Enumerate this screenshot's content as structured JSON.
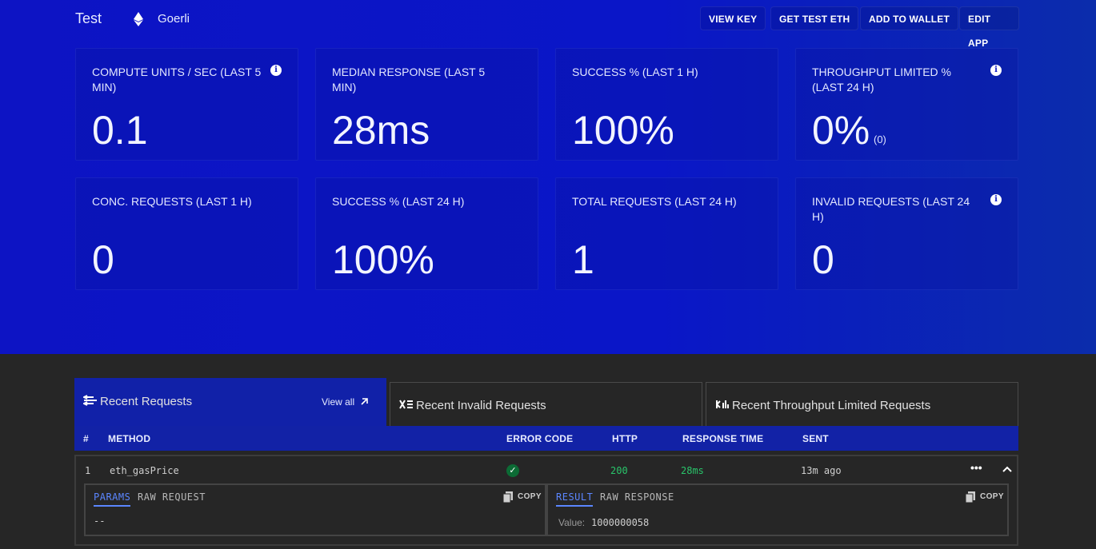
{
  "header": {
    "app_name": "Test",
    "network": "Goerli",
    "buttons": [
      "VIEW KEY",
      "GET TEST ETH",
      "ADD TO WALLET",
      "EDIT APP"
    ]
  },
  "stats": [
    {
      "label": "COMPUTE UNITS / SEC (LAST 5 MIN)",
      "value": "0.1",
      "info": true
    },
    {
      "label": "MEDIAN RESPONSE (LAST 5 MIN)",
      "value": "28ms",
      "info": false
    },
    {
      "label": "SUCCESS % (LAST 1 H)",
      "value": "100%",
      "info": false
    },
    {
      "label": "THROUGHPUT LIMITED % (LAST 24 H)",
      "value": "0%",
      "sub": "(0)",
      "info": true
    },
    {
      "label": "CONC. REQUESTS (LAST 1 H)",
      "value": "0",
      "info": false
    },
    {
      "label": "SUCCESS % (LAST 24 H)",
      "value": "100%",
      "info": false
    },
    {
      "label": "TOTAL REQUESTS (LAST 24 H)",
      "value": "1",
      "info": false
    },
    {
      "label": "INVALID REQUESTS (LAST 24 H)",
      "value": "0",
      "info": true
    }
  ],
  "tabs": {
    "recent": "Recent Requests",
    "view_all": "View all",
    "invalid": "Recent Invalid Requests",
    "throughput": "Recent Throughput Limited Requests"
  },
  "table": {
    "columns": [
      "#",
      "METHOD",
      "ERROR CODE",
      "HTTP",
      "RESPONSE TIME",
      "SENT"
    ],
    "rows": [
      {
        "index": "1",
        "method": "eth_gasPrice",
        "http": "200",
        "response_time": "28ms",
        "sent": "13m ago"
      }
    ]
  },
  "details": {
    "left_tabs": [
      "PARAMS",
      "RAW REQUEST"
    ],
    "left_body": "--",
    "right_tabs": [
      "RESULT",
      "RAW RESPONSE"
    ],
    "value_label": "Value:",
    "value": "1000000058",
    "copy_label": "COPY"
  },
  "colors": {
    "hero": "#0d14c4",
    "tab_active": "#1121a8",
    "success": "#29c46a",
    "link": "#5b86ff"
  }
}
